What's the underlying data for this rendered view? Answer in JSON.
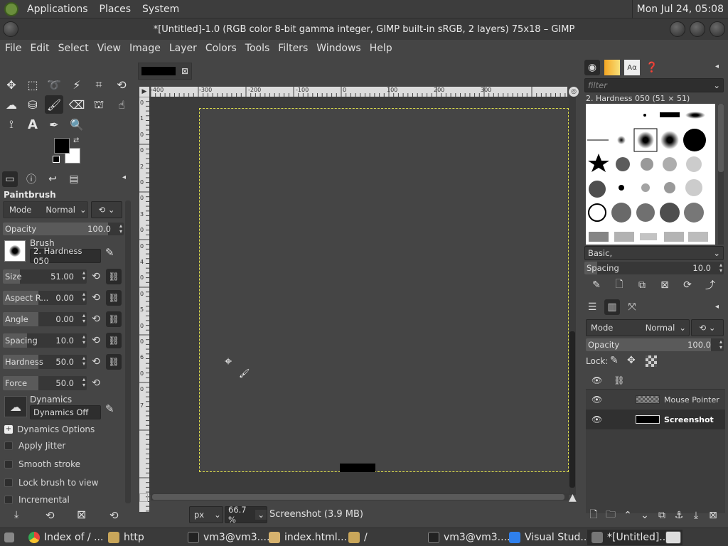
{
  "topbar": {
    "menus": [
      "Applications",
      "Places",
      "System"
    ],
    "clock": "Mon Jul 24, 05:08"
  },
  "window": {
    "title": "*[Untitled]-1.0 (RGB color 8-bit gamma integer, GIMP built-in sRGB, 2 layers) 75x18 – GIMP"
  },
  "menubar": [
    "File",
    "Edit",
    "Select",
    "View",
    "Image",
    "Layer",
    "Colors",
    "Tools",
    "Filters",
    "Windows",
    "Help"
  ],
  "tool_options": {
    "title": "Paintbrush",
    "mode_label": "Mode",
    "mode_value": "Normal",
    "opacity": {
      "label": "Opacity",
      "value": "100.0",
      "fraction": 1.0
    },
    "brush_label": "Brush",
    "brush_value": "2. Hardness 050",
    "size": {
      "label": "Size",
      "value": "51.00",
      "fraction": 0.5
    },
    "aspect": {
      "label": "Aspect R...",
      "value": "0.00",
      "fraction": 0.5
    },
    "angle": {
      "label": "Angle",
      "value": "0.00",
      "fraction": 0.5
    },
    "spacing": {
      "label": "Spacing",
      "value": "10.0",
      "fraction": 0.33
    },
    "hardness": {
      "label": "Hardness",
      "value": "50.0",
      "fraction": 0.5
    },
    "force": {
      "label": "Force",
      "value": "50.0",
      "fraction": 0.5
    },
    "dynamics_label": "Dynamics",
    "dynamics_value": "Dynamics Off",
    "dynamics_options": "Dynamics Options",
    "checks": [
      "Apply Jitter",
      "Smooth stroke",
      "Lock brush to view",
      "Incremental"
    ]
  },
  "canvas": {
    "ruler_h": [
      "-400",
      "-300",
      "-200",
      "-100",
      "0",
      "100",
      "200",
      "300"
    ],
    "ruler_v": [
      "0",
      "1",
      "0",
      "0",
      "2",
      "0",
      "0",
      "3",
      "0",
      "0",
      "4",
      "0",
      "0",
      "5",
      "0",
      "0",
      "6",
      "0",
      "0",
      "7"
    ],
    "unit": "px",
    "zoom": "66.7 %",
    "status": "Screenshot (3.9 MB)"
  },
  "brushes": {
    "filter_placeholder": "filter",
    "selected": "2. Hardness 050 (51 × 51)",
    "tag": "Basic,",
    "spacing_label": "Spacing",
    "spacing_value": "10.0"
  },
  "layers": {
    "mode_label": "Mode",
    "mode_value": "Normal",
    "opacity_label": "Opacity",
    "opacity_value": "100.0",
    "lock_label": "Lock:",
    "items": [
      {
        "name": "Mouse Pointer",
        "active": false
      },
      {
        "name": "Screenshot",
        "active": true
      }
    ]
  },
  "taskbar": [
    {
      "label": "Index of / ...",
      "color": "#e8453c"
    },
    {
      "label": "http",
      "color": "#c9a65a"
    },
    {
      "label": "vm3@vm3....",
      "color": "#555555"
    },
    {
      "label": "index.html...",
      "color": "#d6b26e"
    },
    {
      "label": "/",
      "color": "#c9a65a"
    },
    {
      "label": "vm3@vm3....",
      "color": "#555555"
    },
    {
      "label": "Visual Stud...",
      "color": "#2f80ed"
    },
    {
      "label": "*[Untitled]...",
      "color": "#777777"
    }
  ]
}
